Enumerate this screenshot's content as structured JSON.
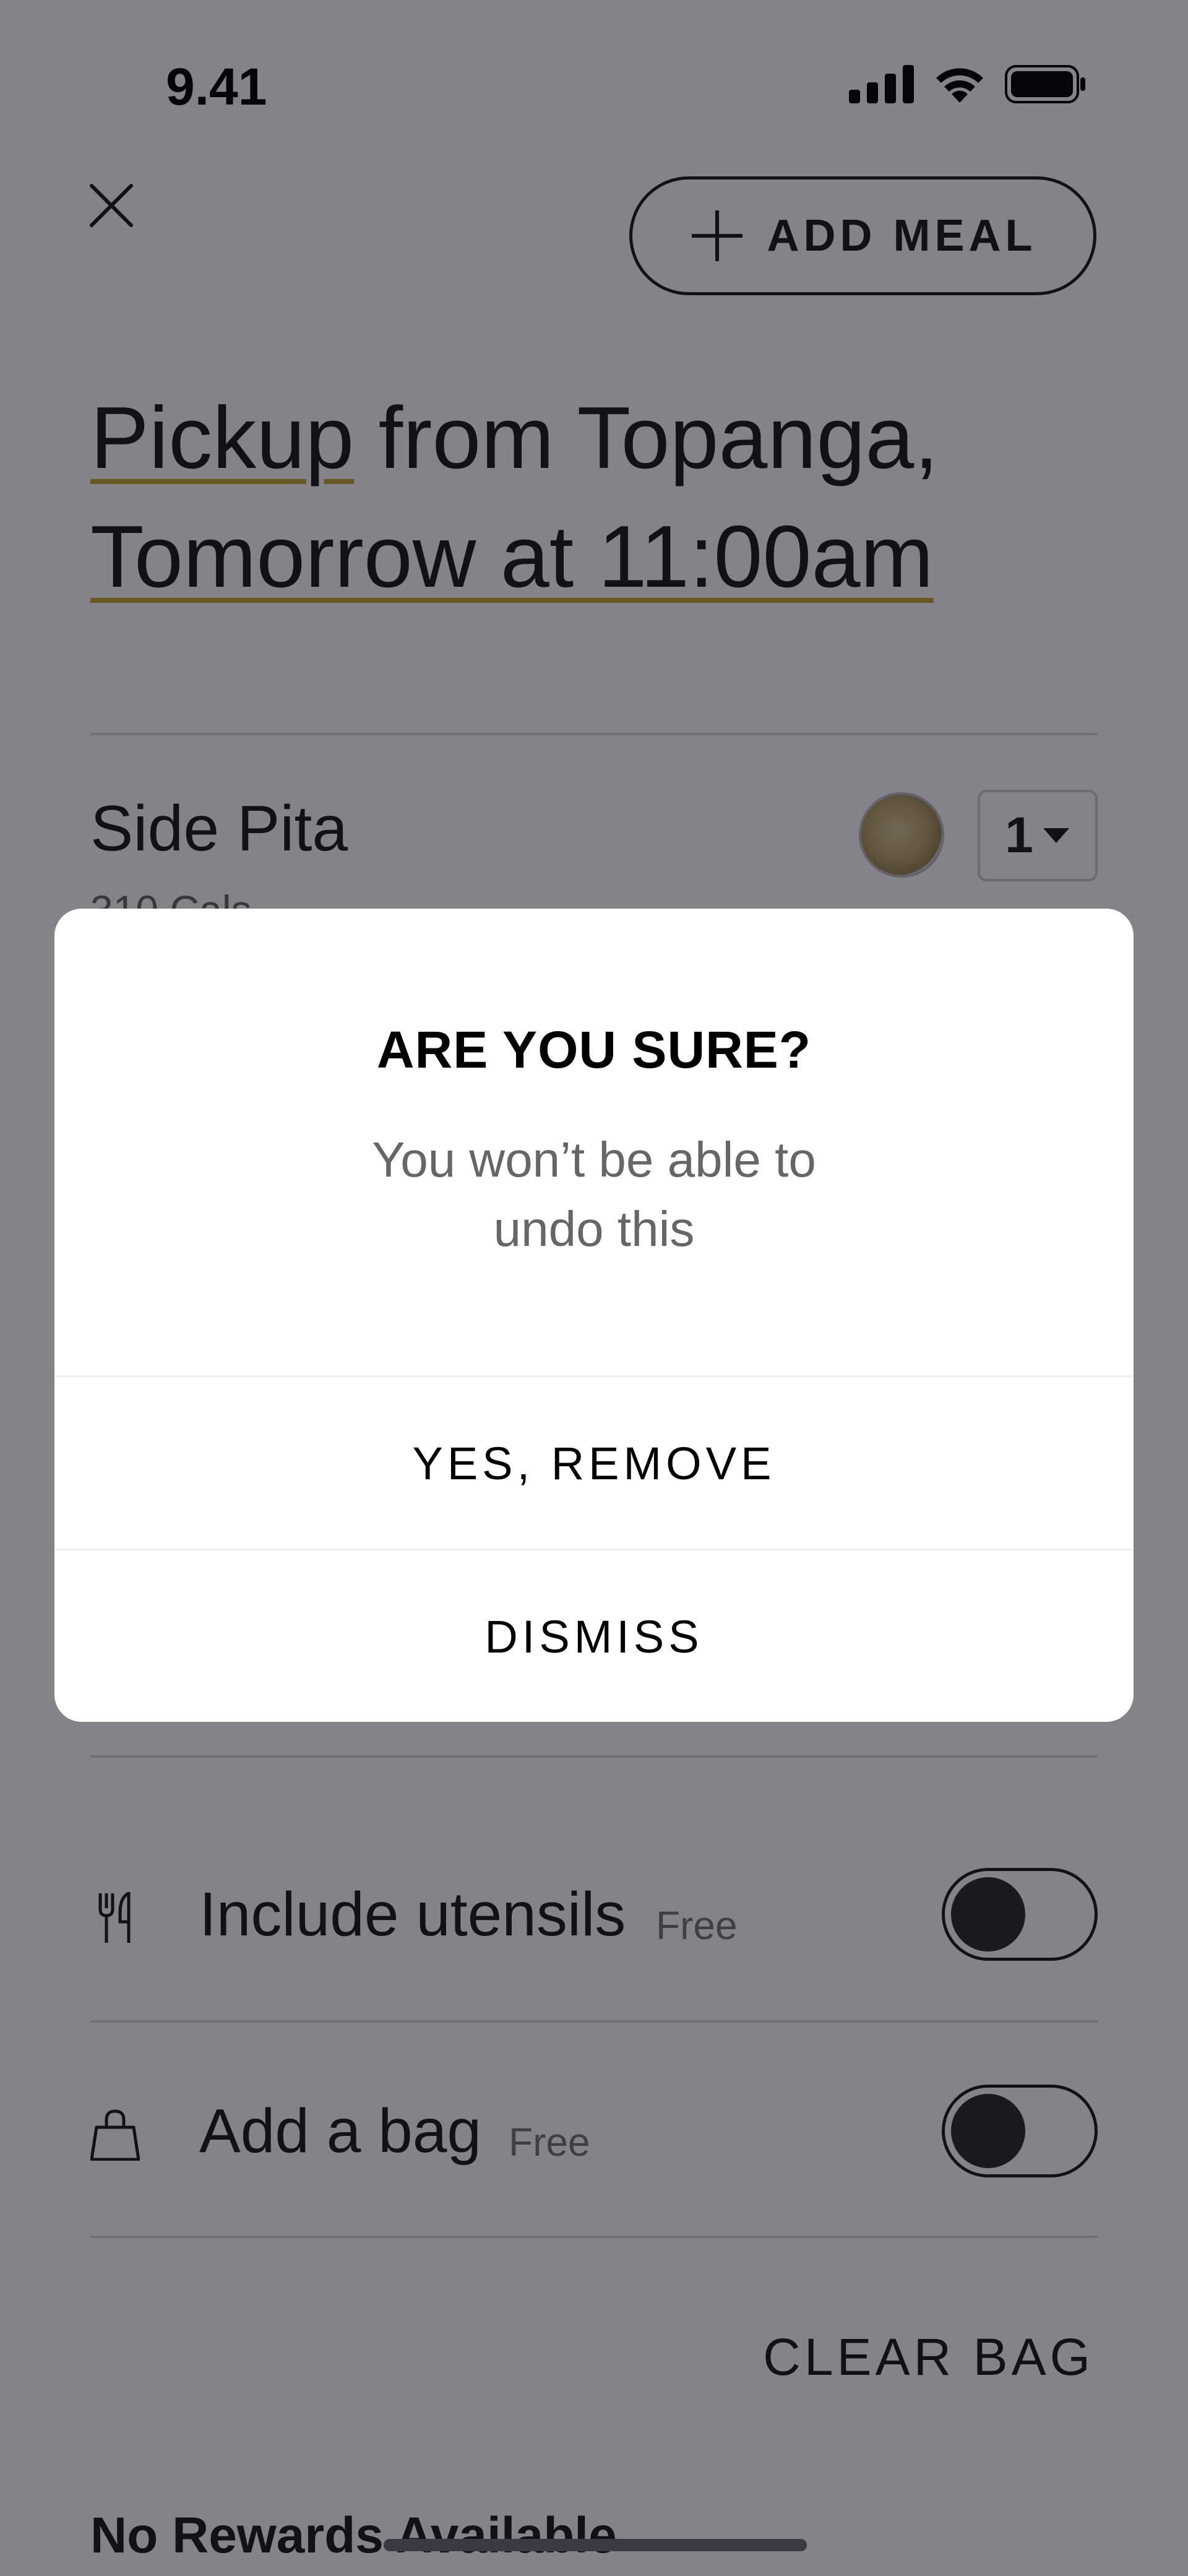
{
  "status_bar": {
    "time": "9.41",
    "icons": [
      "signal-icon",
      "wifi-icon",
      "battery-icon"
    ]
  },
  "header": {
    "close_icon": "close-icon",
    "add_meal_label": "ADD MEAL",
    "add_meal_icon": "plus-icon"
  },
  "title": {
    "pickup_word": "Pickup",
    "location_text": " from Topanga,",
    "time_text": "Tomorrow at 11:00am",
    "underline_color": "#c7a92d"
  },
  "order": {
    "items": [
      {
        "name": "Side Pita",
        "calories": "310 Cals",
        "quantity": "1"
      }
    ]
  },
  "options": {
    "utensils": {
      "label": "Include utensils",
      "note": "Free",
      "icon": "fork-knife-icon",
      "enabled": false
    },
    "bag": {
      "label": "Add a bag",
      "note": "Free",
      "icon": "shopping-bag-icon",
      "enabled": false
    }
  },
  "clear_bag_label": "CLEAR BAG",
  "rewards_label": "No Rewards Available",
  "modal": {
    "title": "ARE YOU SURE?",
    "body_line1": "You won’t be able to",
    "body_line2": "undo this",
    "confirm_label": "YES, REMOVE",
    "dismiss_label": "DISMISS"
  },
  "colors": {
    "overlay": "rgba(8,8,20,0.5)",
    "text": "#1a1a1a",
    "muted": "#666666",
    "accent_underline": "#c7a92d"
  }
}
